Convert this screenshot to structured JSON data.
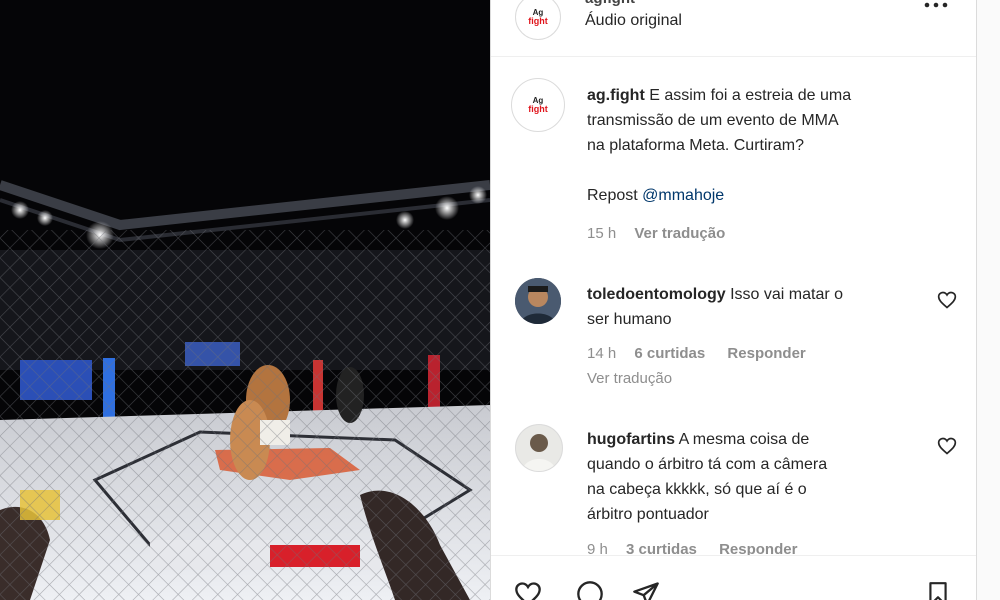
{
  "post": {
    "account": "ag.fight",
    "header_username": "agfight",
    "header_sub": "Áudio original",
    "logo_small": "Ag",
    "logo_big": "fight",
    "caption_username": "ag.fight",
    "caption_text_1": "E assim foi a estreia de uma",
    "caption_text_2": "transmissão de um evento de MMA",
    "caption_text_3": "na plataforma Meta. Curtiram?",
    "repost_label": "Repost",
    "repost_mention": "@mmahoje",
    "caption_time": "15 h",
    "see_translation": "Ver tradução"
  },
  "comments": [
    {
      "username": "toledoentomology",
      "text_1": "Isso vai matar o",
      "text_2": "ser humano",
      "time": "14 h",
      "likes": "6 curtidas",
      "reply": "Responder",
      "translation": "Ver tradução"
    },
    {
      "username": "hugofartins",
      "text_1": "A mesma coisa de",
      "text_2": "quando o árbitro tá com a câmera",
      "text_3": "na cabeça kkkkk, só que aí é o",
      "text_4": "árbitro pontuador",
      "time": "9 h",
      "likes": "3 curtidas",
      "reply": "Responder"
    }
  ],
  "icons": {
    "more": "more-options-icon",
    "like": "heart-icon",
    "comment": "comment-icon",
    "share": "share-icon",
    "save": "bookmark-icon"
  },
  "colors": {
    "brand_red": "#e0141b",
    "mention_blue": "#00376b",
    "muted": "#8e8e8e"
  }
}
